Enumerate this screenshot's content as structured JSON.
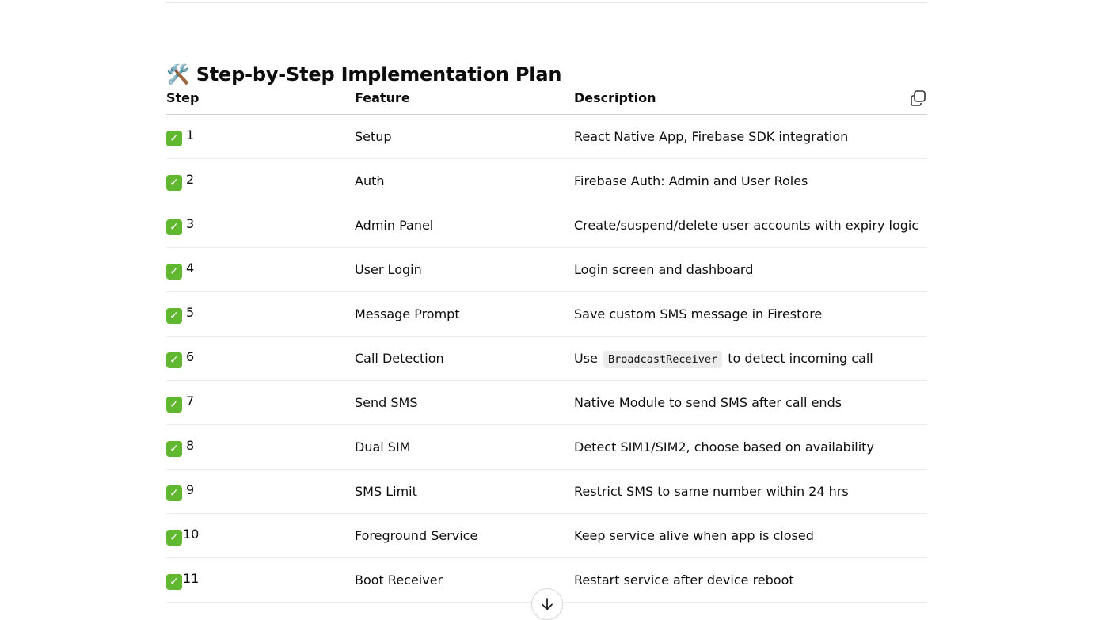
{
  "section": {
    "icon": "hammer-and-wrench-icon",
    "icon_glyph": "🛠️",
    "title": "Step-by-Step Implementation Plan"
  },
  "table": {
    "headers": [
      "Step",
      "Feature",
      "Description"
    ],
    "check_glyph": "✓",
    "rows": [
      {
        "step": "1",
        "feature": "Setup",
        "description": "React Native App, Firebase SDK integration"
      },
      {
        "step": "2",
        "feature": "Auth",
        "description": "Firebase Auth: Admin and User Roles"
      },
      {
        "step": "3",
        "feature": "Admin Panel",
        "description": "Create/suspend/delete user accounts with expiry logic"
      },
      {
        "step": "4",
        "feature": "User Login",
        "description": "Login screen and dashboard"
      },
      {
        "step": "5",
        "feature": "Message Prompt",
        "description": "Save custom SMS message in Firestore"
      },
      {
        "step": "6",
        "feature": "Call Detection",
        "description_pre": "Use",
        "description_code": "BroadcastReceiver",
        "description_post": "to detect incoming call"
      },
      {
        "step": "7",
        "feature": "Send SMS",
        "description": "Native Module to send SMS after call ends"
      },
      {
        "step": "8",
        "feature": "Dual SIM",
        "description": "Detect SIM1/SIM2, choose based on availability"
      },
      {
        "step": "9",
        "feature": "SMS Limit",
        "description": "Restrict SMS to same number within 24 hrs"
      },
      {
        "step": "10",
        "feature": "Foreground Service",
        "description": "Keep service alive when app is closed"
      },
      {
        "step": "11",
        "feature": "Boot Receiver",
        "description": "Restart service after device reboot"
      }
    ]
  },
  "icons": {
    "copy": "copy-icon",
    "scroll_down": "arrow-down-icon",
    "check": "check-mark-icon"
  },
  "colors": {
    "check_green": "#5fb830",
    "text": "#0d0d0d",
    "divider": "#ececec"
  }
}
